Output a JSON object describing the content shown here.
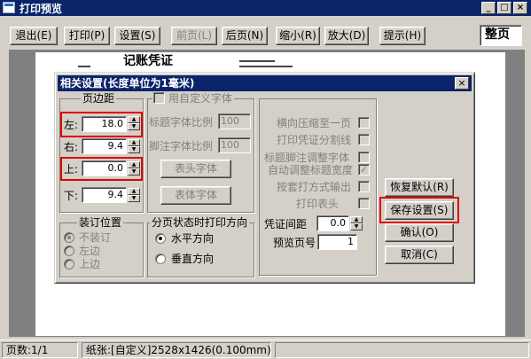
{
  "window": {
    "title": "打印预览",
    "min": "_",
    "max": "□",
    "close": "×"
  },
  "toolbar": {
    "exit": "退出(E)",
    "print": "打印(P)",
    "settings": "设置(S)",
    "prev": "前页(L)",
    "next": "后页(N)",
    "zoom_out": "缩小(R)",
    "zoom_in": "放大(D)",
    "hint": "提示(H)",
    "page_mode": "整页"
  },
  "page": {
    "heading": "记账凭证"
  },
  "dialog": {
    "title": "相关设置(长度单位为1毫米)",
    "close": "×",
    "margins": {
      "title": "页边距",
      "left_label": "左:",
      "left_value": "18.0",
      "right_label": "右:",
      "right_value": "9.4",
      "top_label": "上:",
      "top_value": "0.0",
      "bottom_label": "下:",
      "bottom_value": "9.4"
    },
    "custom_font": {
      "title": "用自定义字体",
      "title_ratio_label": "标题字体比例",
      "title_ratio_value": "100",
      "footnote_ratio_label": "脚注字体比例",
      "footnote_ratio_value": "100",
      "header_font_btn": "表头字体",
      "body_font_btn": "表体字体"
    },
    "options": [
      {
        "label": "横向压缩至一页",
        "checked": false
      },
      {
        "label": "打印凭证分割线",
        "checked": false
      },
      {
        "label": "标题脚注调整字体",
        "checked": false
      },
      {
        "label": "自动调整标题宽度",
        "checked": true
      },
      {
        "label": "按套打方式输出",
        "checked": false
      },
      {
        "label": "打印表头",
        "checked": false
      }
    ],
    "binding": {
      "title": "装订位置",
      "none": "不装订",
      "left": "左边",
      "top": "上边",
      "selected": "none"
    },
    "direction": {
      "title": "分页状态时打印方向",
      "horizontal": "水平方向",
      "vertical": "垂直方向",
      "selected": "horizontal"
    },
    "voucher_gap_label": "凭证间距",
    "voucher_gap_value": "0.0",
    "preview_pages_label": "预览页号",
    "preview_pages_value": "1",
    "buttons": {
      "restore": "恢复默认(R)",
      "save": "保存设置(S)",
      "ok": "确认(O)",
      "cancel": "取消(C)"
    }
  },
  "statusbar": {
    "pages": "页数:1/1",
    "paper": "纸张:[自定义]2528x1426(0.100mm)"
  },
  "colors": {
    "highlight": "#e00000",
    "titlebar": "#0a246a"
  }
}
